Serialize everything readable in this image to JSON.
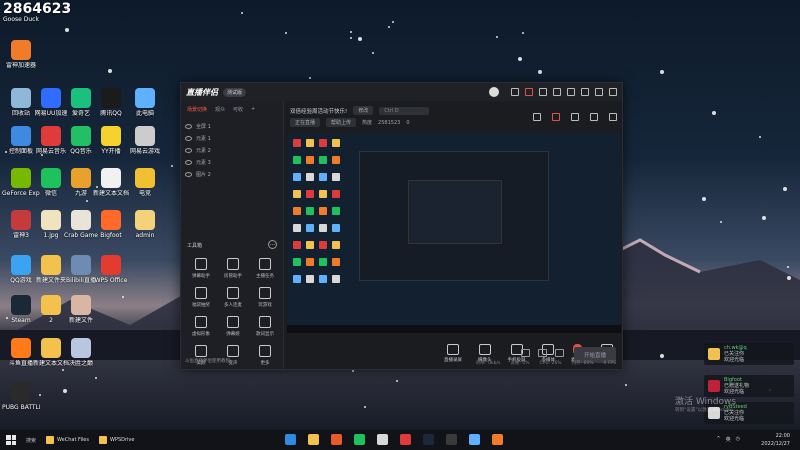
{
  "top_left": {
    "count": "2864623",
    "label": "Goose Duck"
  },
  "desktop_icons": [
    {
      "label": "雷神加速器",
      "color": "#f07c2a"
    },
    {
      "label": "回收站",
      "color": "#8fb8d8"
    },
    {
      "label": "网易UU加速",
      "color": "#2f6cff"
    },
    {
      "label": "爱奇艺",
      "color": "#19c07e"
    },
    {
      "label": "腾讯QQ",
      "color": "#1b1b1b"
    },
    {
      "label": "此电脑",
      "color": "#5fb0ff"
    },
    {
      "label": "控制面板",
      "color": "#3d8ae0"
    },
    {
      "label": "网易云音乐",
      "color": "#e03b3b"
    },
    {
      "label": "QQ音乐",
      "color": "#22c063"
    },
    {
      "label": "YY开播",
      "color": "#f6d22e"
    },
    {
      "label": "网易云游戏",
      "color": "#cccccc"
    },
    {
      "label": "GeForce Experience",
      "color": "#76b900"
    },
    {
      "label": "微信",
      "color": "#1ec15b"
    },
    {
      "label": "九游",
      "color": "#e8a12c"
    },
    {
      "label": "新建文本文档",
      "color": "#f1f1f1"
    },
    {
      "label": "电竞",
      "color": "#f0c030"
    },
    {
      "label": "雷神3",
      "color": "#c53a3a"
    },
    {
      "label": "1.jpg",
      "color": "#f0e4c0"
    },
    {
      "label": "Crab Game",
      "color": "#e9e4d7"
    },
    {
      "label": "Bigfoot",
      "color": "#ff6a2a"
    },
    {
      "label": "admin",
      "color": "#f3d27a"
    },
    {
      "label": "QQ游戏",
      "color": "#3aa3f2"
    },
    {
      "label": "新建文件夹",
      "color": "#f2c14e"
    },
    {
      "label": "Bilibili直播",
      "color": "#6d8bb3"
    },
    {
      "label": "WPS Office",
      "color": "#e33b30"
    },
    {
      "label": "Steam",
      "color": "#1b2838"
    },
    {
      "label": "2",
      "color": "#f2c14e"
    },
    {
      "label": "新建文件",
      "color": "#d9b6a4"
    },
    {
      "label": "斗鱼直播",
      "color": "#ff7b1a"
    },
    {
      "label": "新建文本文档",
      "color": "#f2c14e"
    },
    {
      "label": "决胜之巅",
      "color": "#b9c6e0"
    },
    {
      "label": "PUBG BATTLEGR...",
      "color": "#2a2a2a"
    }
  ],
  "app": {
    "logo": "直播伴侣",
    "version": "测试版",
    "left_tabs": [
      "场景切换",
      "观众",
      "可收",
      "+"
    ],
    "scenes": [
      {
        "label": "全屏 1"
      },
      {
        "label": "元素 1"
      },
      {
        "label": "元素 2"
      },
      {
        "label": "元素 3"
      },
      {
        "label": "图片 2"
      }
    ],
    "toolbox_title": "工具箱",
    "tools": [
      {
        "label": "弹幕助手"
      },
      {
        "label": "房管助手"
      },
      {
        "label": "主播任务"
      },
      {
        "label": "福袋抽奖"
      },
      {
        "label": "多人连麦"
      },
      {
        "label": "玩游戏"
      },
      {
        "label": "虚拟形象"
      },
      {
        "label": "弹幕姬"
      },
      {
        "label": "歌词显示"
      },
      {
        "label": "美颜"
      },
      {
        "label": "变声"
      },
      {
        "label": "更多"
      }
    ],
    "left_footer": "斗鱼直播伴侣使用教程",
    "event_title": "双倍经验周活动节快乐!",
    "event_chip": "修改",
    "event_input": "Ctrl D",
    "info_chips": [
      "正在直播",
      "帮助上传"
    ],
    "info_fans": "热度",
    "info_count": "2581523",
    "info_zero": "0",
    "controls": [
      {
        "label": "直播录屏"
      },
      {
        "label": "摄像头"
      },
      {
        "label": "手机投屏"
      },
      {
        "label": "多媒体"
      },
      {
        "label": "麦克风",
        "red": true
      },
      {
        "label": "扬声器"
      }
    ],
    "start_button": "开始直播",
    "status": [
      "码率: 0kb/s",
      "丢帧: 0%",
      "CPU: 26%",
      "内存: 60%",
      "0 FPS"
    ]
  },
  "notifications": [
    {
      "name": "ch.wk@q",
      "text": "已关注你",
      "sub": "欢迎光临",
      "color": "#f2c14e"
    },
    {
      "name": "Bigfoot",
      "text": "已赠送礼物",
      "sub": "欢迎光临",
      "color": "#c0203a"
    },
    {
      "name": "ryBSteed",
      "text": "已关注你",
      "sub": "欢迎光临",
      "color": "#d8d8d8"
    }
  ],
  "activate": {
    "title": "激活 Windows",
    "sub": "转到“设置”以激活 Windows。"
  },
  "taskbar": {
    "search": "搜索",
    "tasks": [
      {
        "label": "WeChat Files"
      },
      {
        "label": "WPSDrive"
      }
    ],
    "tray": [
      "^",
      "英",
      "◷"
    ],
    "time": "22:00",
    "date": "2022/12/27"
  }
}
